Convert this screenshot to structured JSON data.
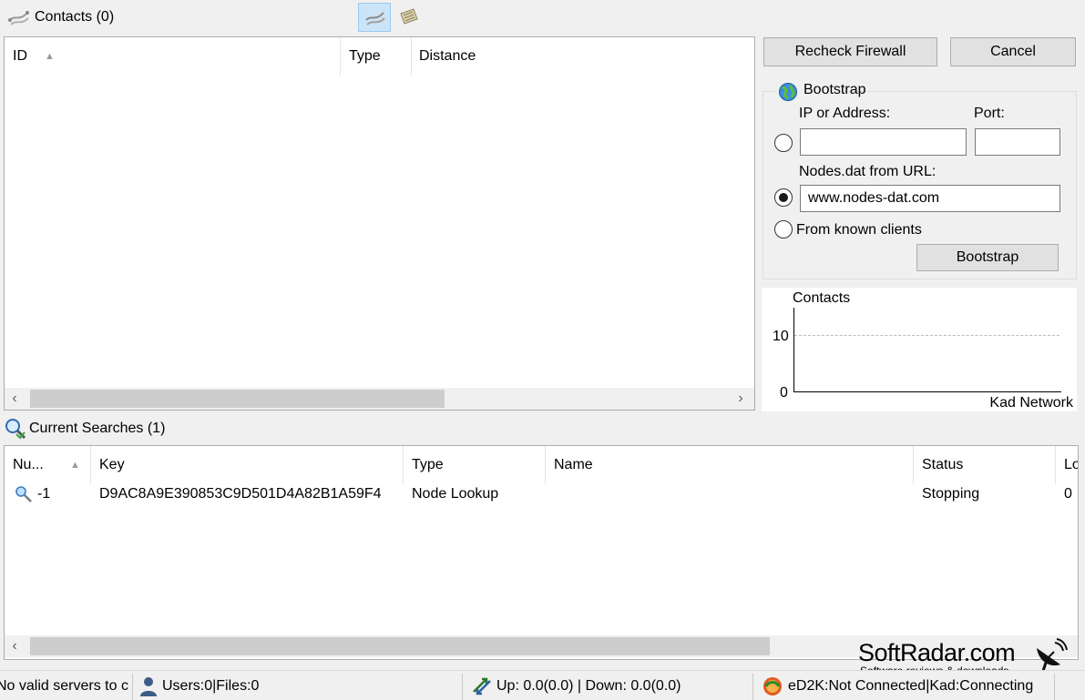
{
  "contacts_panel": {
    "title": "Contacts (0)",
    "columns": [
      "ID",
      "Type",
      "Distance"
    ]
  },
  "actions": {
    "recheck_firewall": "Recheck Firewall",
    "cancel": "Cancel"
  },
  "bootstrap": {
    "group_title": "Bootstrap",
    "ip_label": "IP or Address:",
    "port_label": "Port:",
    "ip_value": "",
    "port_value": "",
    "nodes_label": "Nodes.dat from URL:",
    "nodes_value": "www.nodes-dat.com",
    "known_clients_label": "From known clients",
    "selected_option": "nodes_url",
    "button": "Bootstrap"
  },
  "graph": {
    "title": "Contacts",
    "y_ticks": [
      "10",
      "0"
    ],
    "x_label": "Kad Network"
  },
  "searches_panel": {
    "title": "Current Searches (1)",
    "columns": [
      "Nu...",
      "Key",
      "Type",
      "Name",
      "Status",
      "Lo"
    ],
    "rows": [
      {
        "number": "-1",
        "key": "D9AC8A9E390853C9D501D4A82B1A59F4",
        "type": "Node Lookup",
        "name": "",
        "status": "Stopping",
        "load": "0"
      }
    ]
  },
  "watermark": {
    "brand": "SoftRadar.com",
    "tagline": "Software reviews & downloads"
  },
  "status_bar": {
    "server": "No valid servers to c",
    "users": "Users:0|Files:0",
    "transfer": "Up: 0.0(0.0) | Down: 0.0(0.0)",
    "network": "eD2K:Not Connected|Kad:Connecting"
  },
  "colors": {
    "accent_toggle": "#cce4f7",
    "grid_line": "#bcbcbc"
  }
}
